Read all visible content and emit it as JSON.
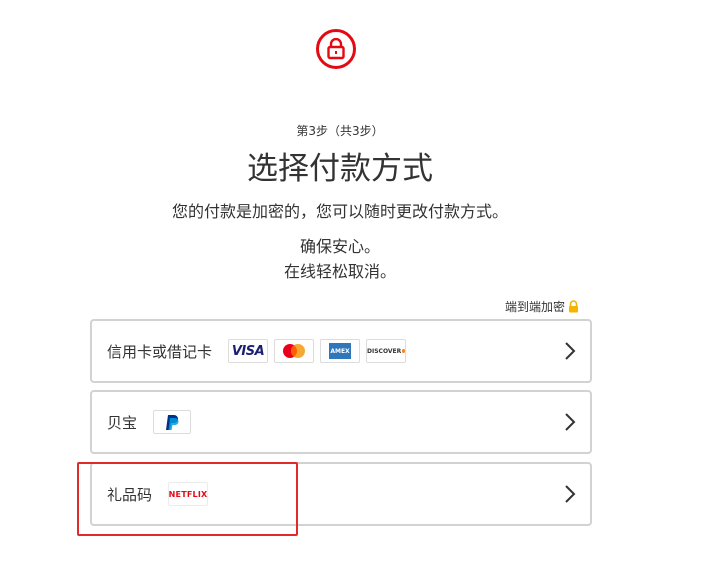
{
  "header": {
    "step_text": "第3步（共3步）",
    "title": "选择付款方式",
    "subtitle": "您的付款是加密的，您可以随时更改付款方式。",
    "line1": "确保安心。",
    "line2": "在线轻松取消。"
  },
  "encrypted_label": "端到端加密",
  "options": [
    {
      "label": "信用卡或借记卡",
      "logos": [
        "VISA",
        "mastercard",
        "AMEX",
        "DISCOVER"
      ]
    },
    {
      "label": "贝宝",
      "logos": [
        "PayPal"
      ]
    },
    {
      "label": "礼品码",
      "logos": [
        "NETFLIX"
      ]
    }
  ],
  "colors": {
    "brand_red": "#e50914",
    "highlight_red": "#e12a2a",
    "lock_gold": "#f5b400"
  },
  "icons": [
    "lock-icon",
    "padlock-small-icon",
    "chevron-right-icon"
  ]
}
